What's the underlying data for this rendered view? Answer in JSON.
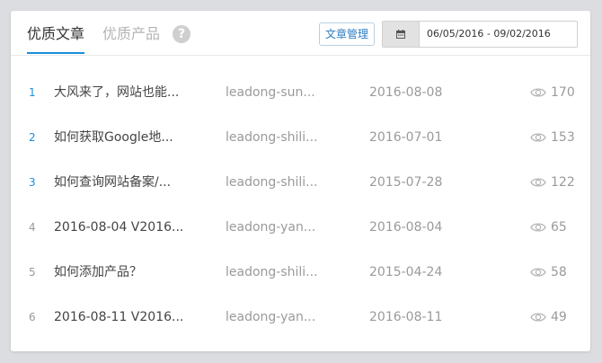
{
  "tabs": {
    "active": "优质文章",
    "inactive": "优质产品",
    "help": "?"
  },
  "toolbar": {
    "manage_label": "文章管理",
    "date_range": "06/05/2016 - 09/02/2016"
  },
  "icons": {
    "help": "question-circle-icon",
    "calendar": "calendar-icon",
    "views": "eye-icon"
  },
  "colors": {
    "accent": "#1a8fd6",
    "muted": "#9a9a9a"
  },
  "articles": [
    {
      "rank": "1",
      "title": "大风来了，网站也能...",
      "author": "leadong-sun...",
      "date": "2016-08-08",
      "views": "170"
    },
    {
      "rank": "2",
      "title": "如何获取Google地...",
      "author": "leadong-shili...",
      "date": "2016-07-01",
      "views": "153"
    },
    {
      "rank": "3",
      "title": "如何查询网站备案/...",
      "author": "leadong-shili...",
      "date": "2015-07-28",
      "views": "122"
    },
    {
      "rank": "4",
      "title": "2016-08-04 V2016...",
      "author": "leadong-yan...",
      "date": "2016-08-04",
      "views": "65"
    },
    {
      "rank": "5",
      "title": "如何添加产品？",
      "author": "leadong-shili...",
      "date": "2015-04-24",
      "views": "58"
    },
    {
      "rank": "6",
      "title": "2016-08-11 V2016...",
      "author": "leadong-yan...",
      "date": "2016-08-11",
      "views": "49"
    }
  ]
}
